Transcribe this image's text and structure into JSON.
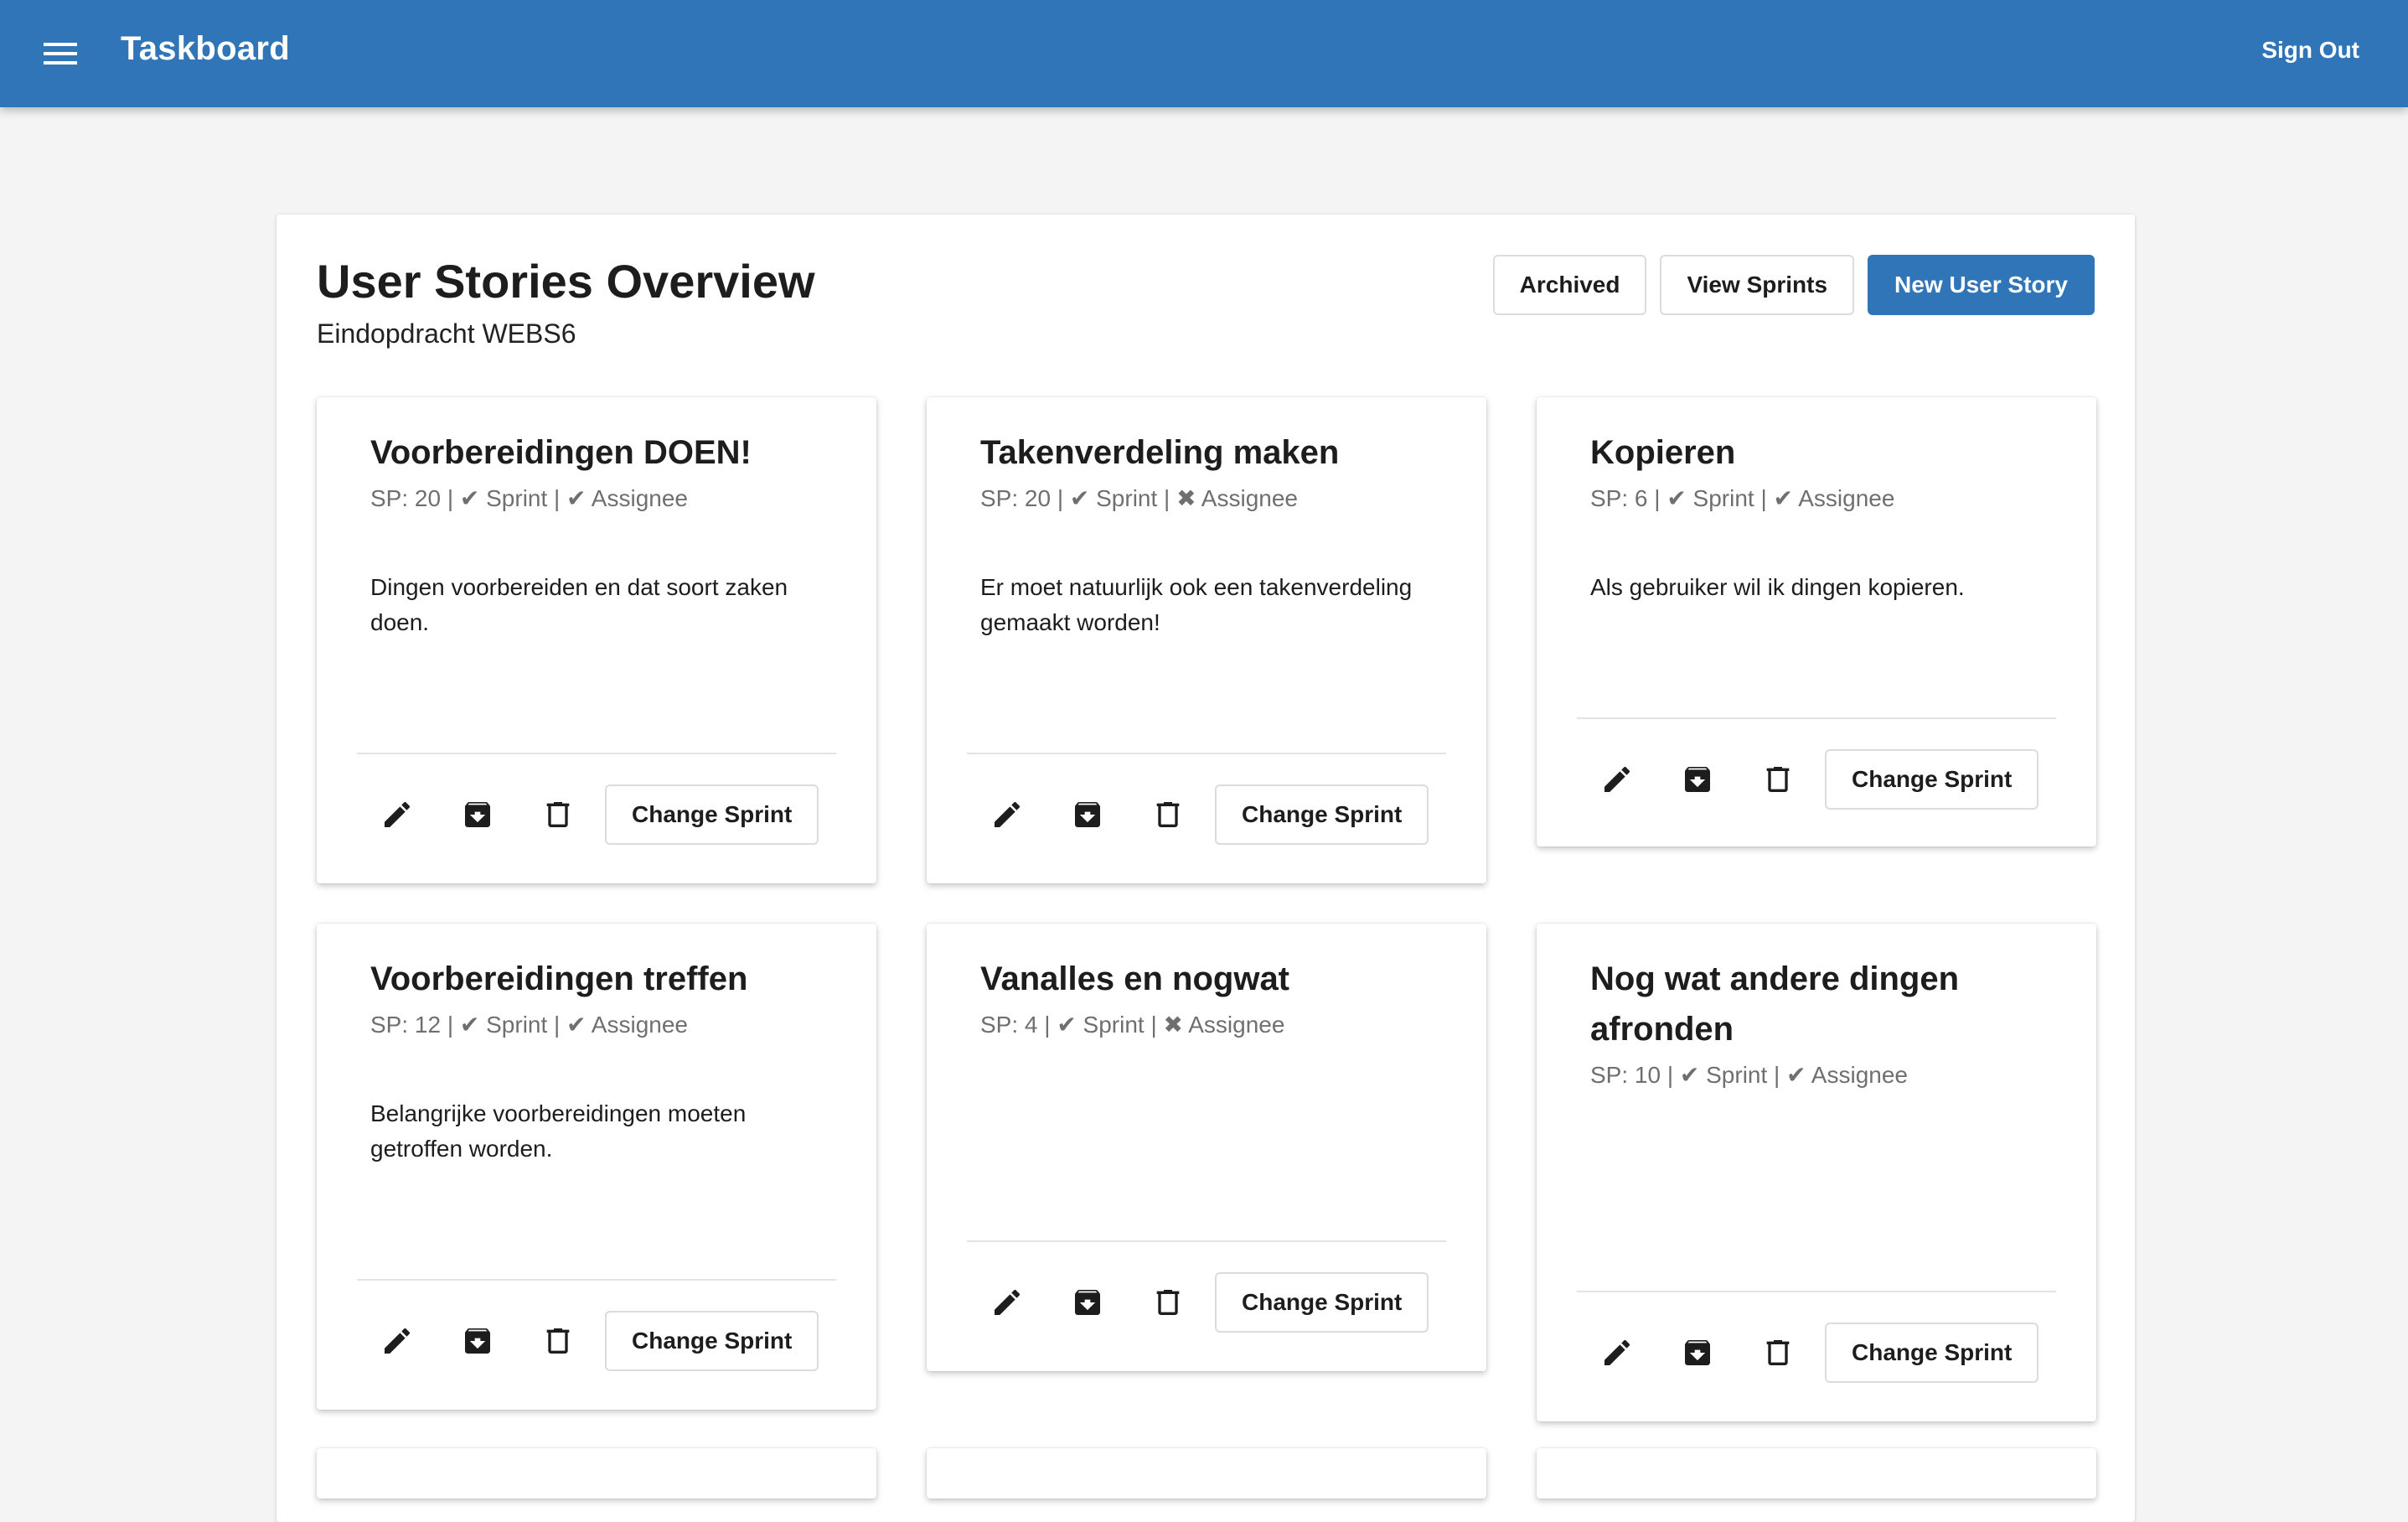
{
  "app": {
    "title": "Taskboard",
    "sign_out": "Sign Out",
    "menu_icon": "menu-icon",
    "accent": "#2f75b7"
  },
  "page": {
    "title": "User Stories Overview",
    "subtitle": "Eindopdracht WEBS6",
    "actions": {
      "archived": "Archived",
      "view_sprints": "View Sprints",
      "new_user_story": "New User Story"
    }
  },
  "cards": [
    {
      "title": "Voorbereidingen DOEN!",
      "meta": "SP: 20 | ✔ Sprint | ✔ Assignee",
      "description": "Dingen voorbereiden en dat soort zaken doen.",
      "change_sprint": "Change Sprint"
    },
    {
      "title": "Takenverdeling maken",
      "meta": "SP: 20 | ✔ Sprint | ✖ Assignee",
      "description": "Er moet natuurlijk ook een takenverdeling gemaakt worden!",
      "change_sprint": "Change Sprint"
    },
    {
      "title": "Kopieren",
      "meta": "SP: 6 | ✔ Sprint | ✔ Assignee",
      "description": "Als gebruiker wil ik dingen kopieren.",
      "change_sprint": "Change Sprint"
    },
    {
      "title": "Voorbereidingen treffen",
      "meta": "SP: 12 | ✔ Sprint | ✔ Assignee",
      "description": "Belangrijke voorbereidingen moeten getroffen worden.",
      "change_sprint": "Change Sprint"
    },
    {
      "title": "Vanalles en nogwat",
      "meta": "SP: 4 | ✔ Sprint | ✖ Assignee",
      "description": "",
      "change_sprint": "Change Sprint"
    },
    {
      "title": "Nog wat andere dingen afronden",
      "meta": "SP: 10 | ✔ Sprint | ✔ Assignee",
      "description": "",
      "change_sprint": "Change Sprint"
    }
  ],
  "card_icons": [
    "edit-icon",
    "archive-icon",
    "delete-icon"
  ]
}
